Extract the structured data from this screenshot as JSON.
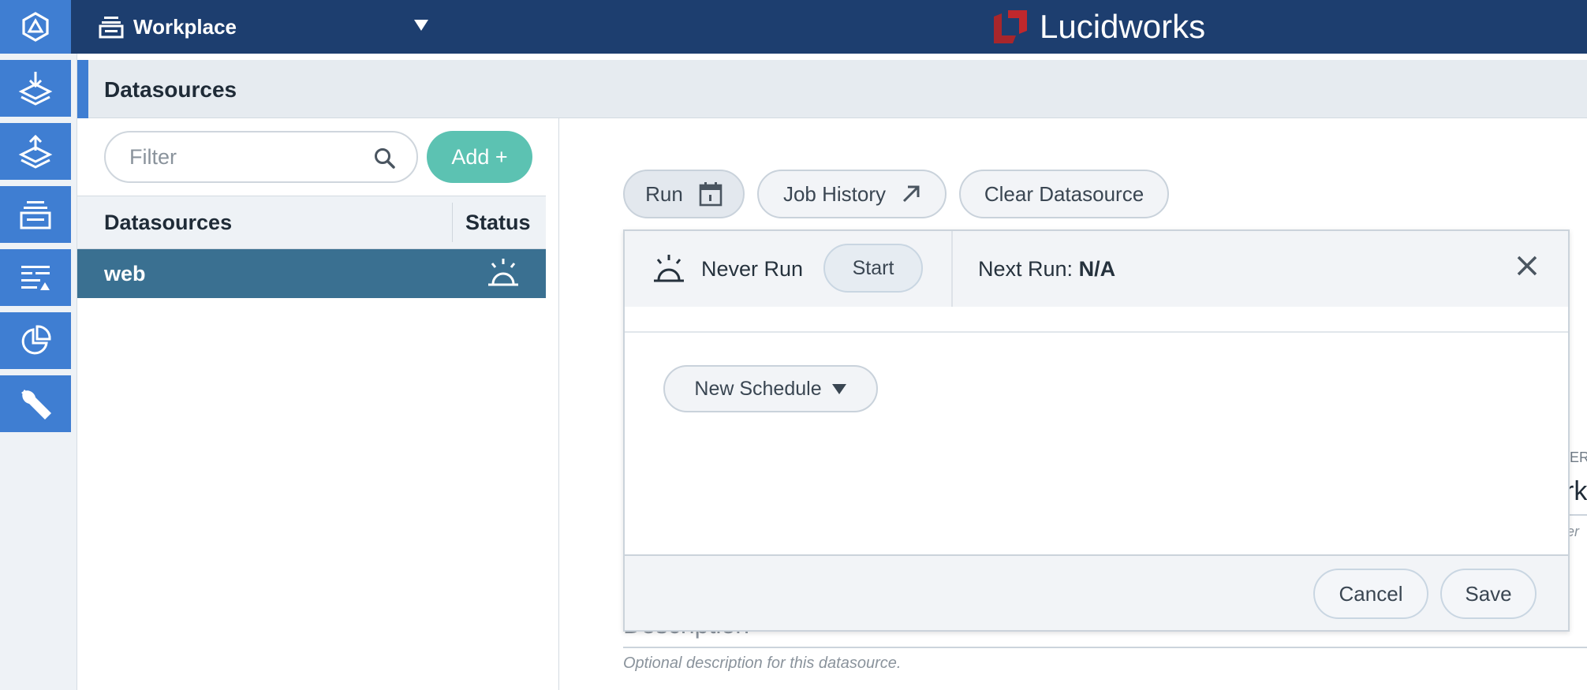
{
  "topbar": {
    "app_name": "Workplace",
    "brand": "Lucidworks",
    "colors": {
      "bar": "#1d3e6f",
      "accent": "#3f7ed2",
      "brand_mark": "#c0282d"
    }
  },
  "leftnav": {
    "items": [
      {
        "icon": "index-in-icon"
      },
      {
        "icon": "query-out-icon"
      },
      {
        "icon": "collections-icon"
      },
      {
        "icon": "relevance-sliders-icon"
      },
      {
        "icon": "analytics-pie-icon"
      },
      {
        "icon": "wrench-icon"
      }
    ]
  },
  "panel": {
    "title": "Datasources"
  },
  "list": {
    "filter_placeholder": "Filter",
    "add_label": "Add +",
    "columns": [
      "Datasources",
      "Status"
    ],
    "rows": [
      {
        "name": "web",
        "status_icon": "sunrise-icon"
      }
    ],
    "colors": {
      "add": "#5cc2b2",
      "selected_row": "#3a7091"
    }
  },
  "toolbar": {
    "run_label": "Run",
    "job_history_label": "Job History",
    "clear_label": "Clear Datasource"
  },
  "schedule": {
    "status_text": "Never Run",
    "start_label": "Start",
    "next_run_label": "Next Run:",
    "next_run_value": "N/A",
    "new_schedule_label": "New Schedule",
    "cancel_label": "Cancel",
    "save_label": "Save"
  },
  "form": {
    "description_label": "Description",
    "description_hint": "Optional description for this datasource.",
    "cut_label_fragment": "ER",
    "cut_value_fragment": "rk",
    "cut_hint_fragment": "er"
  }
}
